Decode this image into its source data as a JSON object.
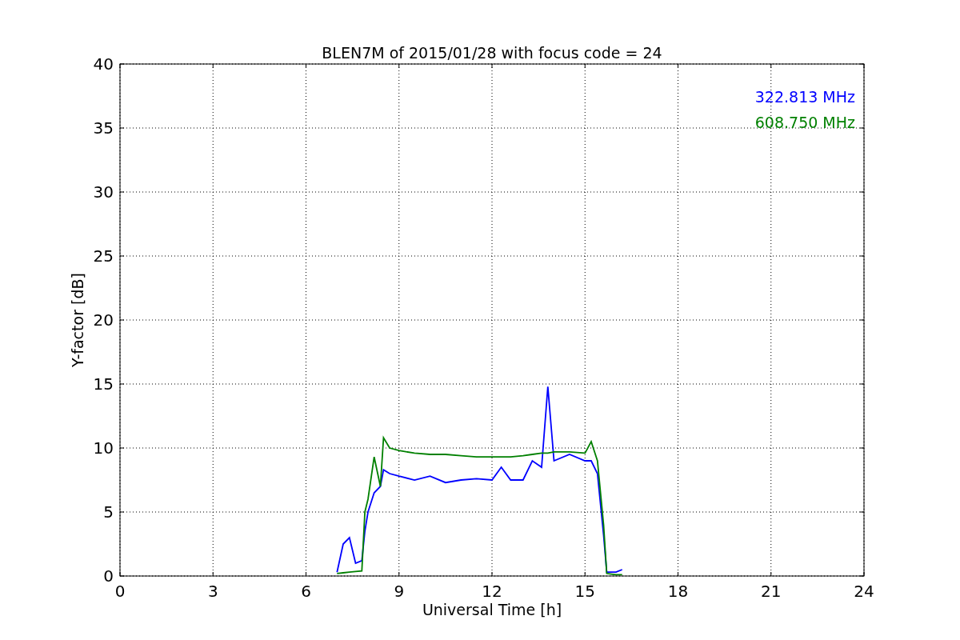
{
  "chart": {
    "chart_data": {
      "type": "line",
      "title": "BLEN7M of 2015/01/28 with focus code = 24",
      "xlabel": "Universal Time [h]",
      "ylabel": "Y-factor [dB]",
      "x": [
        7.0,
        7.2,
        7.4,
        7.6,
        7.8,
        7.9,
        8.0,
        8.2,
        8.4,
        8.5,
        8.7,
        9,
        9.5,
        10,
        10.5,
        11,
        11.5,
        12,
        12.3,
        12.6,
        13,
        13.3,
        13.6,
        13.8,
        14,
        14.5,
        15,
        15.2,
        15.4,
        15.6,
        15.7,
        16,
        16.2
      ],
      "series": [
        {
          "name": "322.813 MHz",
          "color": "#0000ff",
          "values": [
            0.3,
            2.5,
            3.0,
            1.0,
            1.2,
            3.5,
            5,
            6.5,
            7,
            8.3,
            8,
            7.8,
            7.5,
            7.8,
            7.3,
            7.5,
            7.6,
            7.5,
            8.5,
            7.5,
            7.5,
            9,
            8.5,
            14.8,
            9,
            9.5,
            9,
            9,
            8,
            3.2,
            0.3,
            0.3,
            0.5
          ]
        },
        {
          "name": "608.750 MHz",
          "color": "#008000",
          "values": [
            0.2,
            0.25,
            0.3,
            0.35,
            0.4,
            5,
            6,
            9.3,
            7,
            10.8,
            10,
            9.8,
            9.6,
            9.5,
            9.5,
            9.4,
            9.3,
            9.3,
            9.3,
            9.3,
            9.4,
            9.5,
            9.6,
            9.6,
            9.7,
            9.7,
            9.6,
            10.5,
            9,
            4,
            0.2,
            0.1,
            0.1
          ]
        }
      ],
      "grid": true,
      "xlim": [
        0,
        24
      ],
      "ylim": [
        0,
        40
      ],
      "xticks": [
        0,
        3,
        6,
        9,
        12,
        15,
        18,
        21,
        24
      ],
      "yticks": [
        0,
        5,
        10,
        15,
        20,
        25,
        30,
        35,
        40
      ]
    }
  }
}
